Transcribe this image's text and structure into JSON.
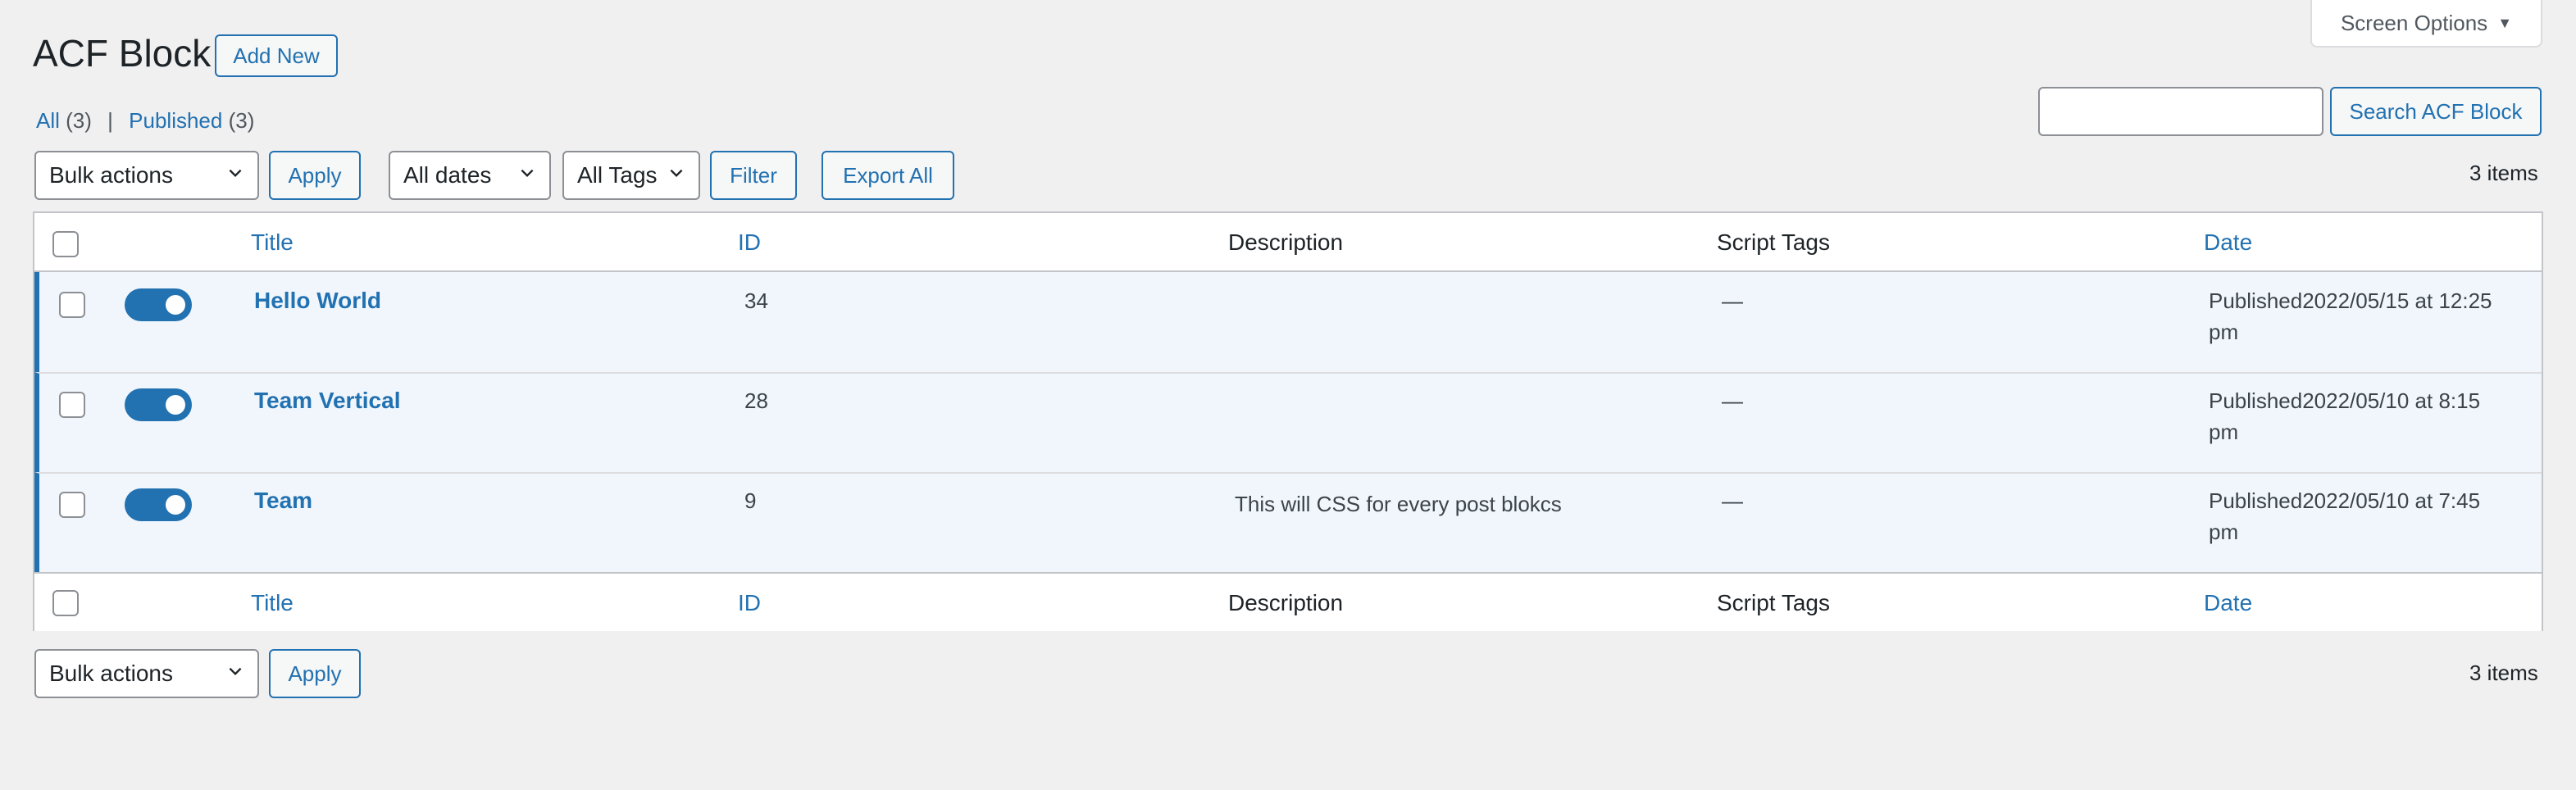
{
  "screen_options": {
    "label": "Screen Options",
    "arrow": "▼"
  },
  "page": {
    "title": "ACF Block",
    "add_new_label": "Add New"
  },
  "views": {
    "all_label": "All",
    "all_count": "(3)",
    "separator": "|",
    "published_label": "Published",
    "published_count": "(3)"
  },
  "search": {
    "value": "",
    "button_label": "Search ACF Block"
  },
  "tablenav_top": {
    "bulk_actions_selected": "Bulk actions",
    "apply_label": "Apply",
    "dates_selected": "All dates",
    "tags_selected": "All Tags",
    "filter_label": "Filter",
    "export_label": "Export All",
    "items_count": "3 items"
  },
  "columns": {
    "title": "Title",
    "id": "ID",
    "description": "Description",
    "script_tags": "Script Tags",
    "date": "Date"
  },
  "rows": [
    {
      "title": "Hello World",
      "id": "34",
      "description": "",
      "script_tags": "—",
      "date_line1": "Published2022/05/15 at 12:25",
      "date_line2": "pm",
      "active": true
    },
    {
      "title": "Team Vertical",
      "id": "28",
      "description": "",
      "script_tags": "—",
      "date_line1": "Published2022/05/10 at 8:15",
      "date_line2": "pm",
      "active": true
    },
    {
      "title": "Team",
      "id": "9",
      "description": "This will CSS for every post blokcs",
      "script_tags": "—",
      "date_line1": "Published2022/05/10 at 7:45",
      "date_line2": "pm",
      "active": true
    }
  ],
  "tablenav_bottom": {
    "bulk_actions_selected": "Bulk actions",
    "apply_label": "Apply",
    "items_count": "3 items"
  },
  "colors": {
    "accent": "#2271b1",
    "toggle_on": "#2271b1",
    "row_highlight": "#f0f6fc",
    "background": "#f0f0f1"
  },
  "icons": {
    "dropdown": "chevron-down-icon",
    "screen_options": "triangle-down-icon"
  }
}
